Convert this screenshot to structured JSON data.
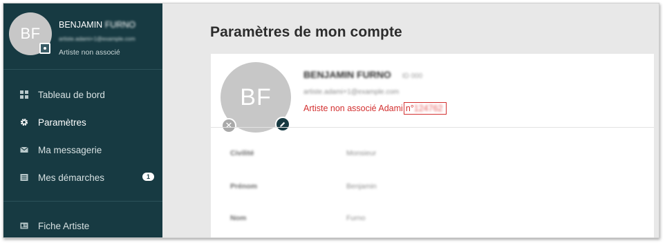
{
  "user": {
    "initials": "BF",
    "name_first": "BENJAMIN",
    "name_last": "FURNO",
    "email": "artiste.adami+1@example.com",
    "status": "Artiste non associé",
    "suffix": "ID 000"
  },
  "sidebar": {
    "items": [
      {
        "label": "Tableau de bord",
        "icon": "dashboard-grid-icon"
      },
      {
        "label": "Paramètres",
        "icon": "gear-icon",
        "active": true
      },
      {
        "label": "Ma messagerie",
        "icon": "envelope-icon"
      },
      {
        "label": "Mes démarches",
        "icon": "list-icon",
        "badge": "1"
      }
    ],
    "bottom_items": [
      {
        "label": "Fiche Artiste",
        "icon": "id-card-icon"
      }
    ]
  },
  "main": {
    "title": "Paramètres de mon compte",
    "card": {
      "status_prefix": "Artiste non associé Adami",
      "adami_prefix": "n°",
      "adami_number": "124762",
      "fields": [
        {
          "label": "Civilité",
          "value": "Monsieur"
        },
        {
          "label": "Prénom",
          "value": "Benjamin"
        },
        {
          "label": "Nom",
          "value": "Furno"
        }
      ]
    }
  },
  "colors": {
    "sidebar_bg": "#173a42",
    "accent_red": "#d32f2f",
    "avatar_gray": "#c7c7c7"
  }
}
